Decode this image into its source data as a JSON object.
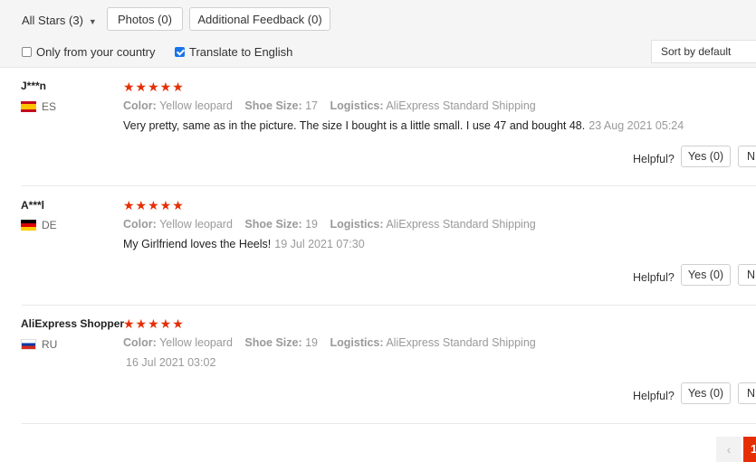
{
  "filters": {
    "all_stars": "All Stars (3)",
    "photos": "Photos (0)",
    "additional_feedback": "Additional Feedback (0)",
    "only_country": "Only from your country",
    "translate": "Translate to English",
    "only_country_checked": false,
    "translate_checked": true,
    "sort": "Sort by default"
  },
  "labels": {
    "color": "Color:",
    "shoe_size": "Shoe Size:",
    "logistics": "Logistics:",
    "helpful": "Helpful?"
  },
  "reviews": [
    {
      "user": "J***n",
      "country": "ES",
      "rating": 5,
      "stars": "★★★★★",
      "color": "Yellow leopard",
      "shoe_size": "17",
      "logistics": "AliExpress Standard Shipping",
      "text": "Very pretty, same as in the picture. The size I bought is a little small. I use 47 and bought 48.",
      "date": "23 Aug 2021 05:24",
      "yes": "Yes (0)",
      "no": "N"
    },
    {
      "user": "A***l",
      "country": "DE",
      "rating": 5,
      "stars": "★★★★★",
      "color": "Yellow leopard",
      "shoe_size": "19",
      "logistics": "AliExpress Standard Shipping",
      "text": "My Girlfriend loves the Heels!",
      "date": "19 Jul 2021 07:30",
      "yes": "Yes (0)",
      "no": "N"
    },
    {
      "user": "AliExpress Shopper",
      "country": "RU",
      "rating": 5,
      "stars": "★★★★★",
      "color": "Yellow leopard",
      "shoe_size": "19",
      "logistics": "AliExpress Standard Shipping",
      "text": "",
      "date": "16 Jul 2021 03:02",
      "yes": "Yes (0)",
      "no": "N"
    }
  ],
  "pagination": {
    "prev": "‹",
    "current": "1"
  },
  "colors": {
    "accent": "#e62e04",
    "checkbox": "#1a73e8"
  }
}
